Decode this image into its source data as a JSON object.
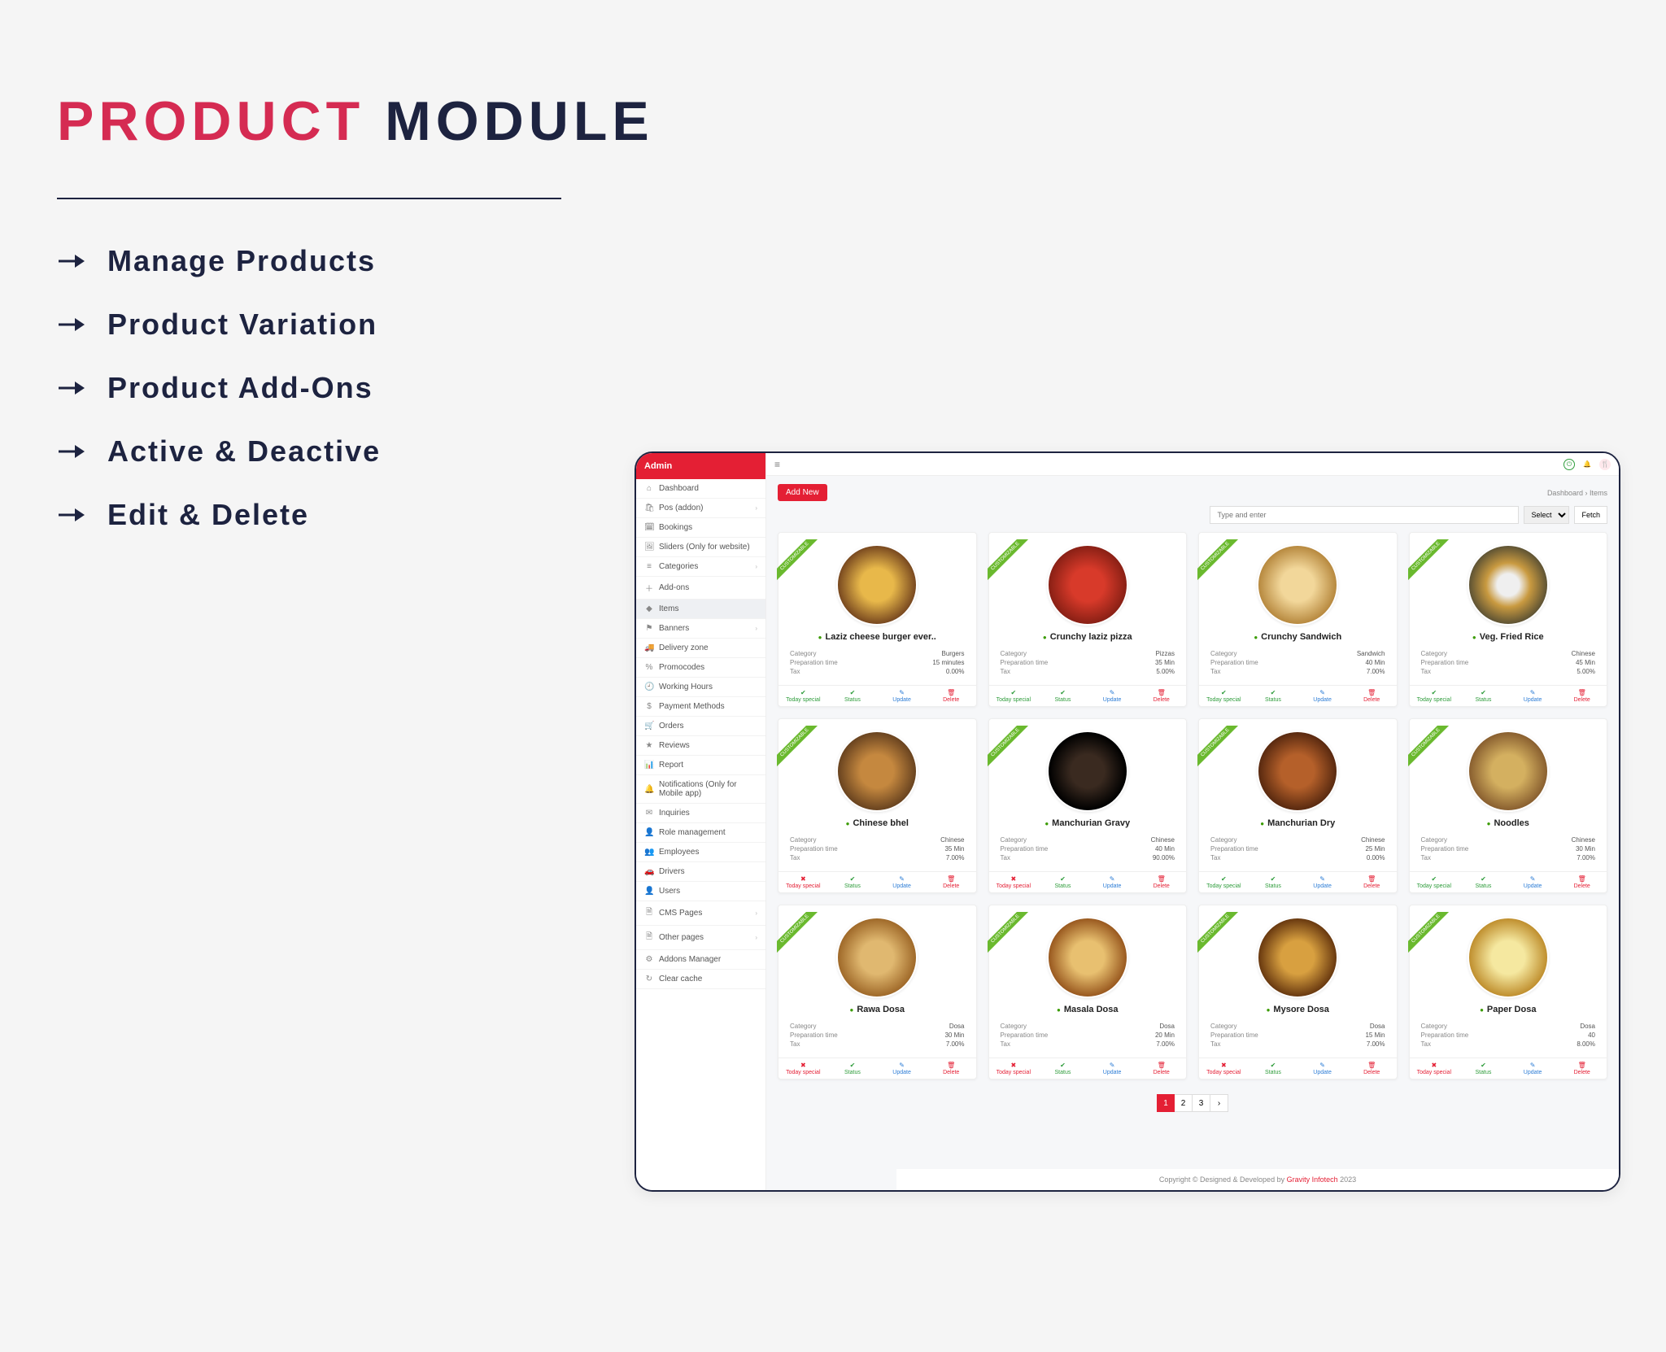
{
  "headline": {
    "word1": "PRODUCT",
    "word2": "MODULE"
  },
  "features": [
    "Manage Products",
    "Product Variation",
    "Product Add-Ons",
    "Active & Deactive",
    "Edit & Delete"
  ],
  "sidebar": {
    "title": "Admin",
    "items": [
      {
        "icon": "⌂",
        "label": "Dashboard",
        "sub": false
      },
      {
        "icon": "🛍",
        "label": "Pos (addon)",
        "sub": true
      },
      {
        "icon": "🗓",
        "label": "Bookings",
        "sub": false
      },
      {
        "icon": "🖼",
        "label": "Sliders (Only for website)",
        "sub": false
      },
      {
        "icon": "≡",
        "label": "Categories",
        "sub": true
      },
      {
        "icon": "＋",
        "label": "Add-ons",
        "sub": false
      },
      {
        "icon": "◆",
        "label": "Items",
        "sub": false,
        "active": true
      },
      {
        "icon": "⚑",
        "label": "Banners",
        "sub": true
      },
      {
        "icon": "🚚",
        "label": "Delivery zone",
        "sub": false
      },
      {
        "icon": "%",
        "label": "Promocodes",
        "sub": false
      },
      {
        "icon": "🕘",
        "label": "Working Hours",
        "sub": false
      },
      {
        "icon": "$",
        "label": "Payment Methods",
        "sub": false
      },
      {
        "icon": "🛒",
        "label": "Orders",
        "sub": false
      },
      {
        "icon": "★",
        "label": "Reviews",
        "sub": false
      },
      {
        "icon": "📊",
        "label": "Report",
        "sub": false
      },
      {
        "icon": "🔔",
        "label": "Notifications (Only for Mobile app)",
        "sub": false
      },
      {
        "icon": "✉",
        "label": "Inquiries",
        "sub": false
      },
      {
        "icon": "👤",
        "label": "Role management",
        "sub": false
      },
      {
        "icon": "👥",
        "label": "Employees",
        "sub": false
      },
      {
        "icon": "🚗",
        "label": "Drivers",
        "sub": false
      },
      {
        "icon": "👤",
        "label": "Users",
        "sub": false
      },
      {
        "icon": "🗎",
        "label": "CMS Pages",
        "sub": true
      },
      {
        "icon": "🗎",
        "label": "Other pages",
        "sub": true
      },
      {
        "icon": "⚙",
        "label": "Addons Manager",
        "sub": false
      },
      {
        "icon": "↻",
        "label": "Clear cache",
        "sub": false
      }
    ]
  },
  "topbar": {
    "breadcrumb_root": "Dashboard",
    "breadcrumb_leaf": "Items"
  },
  "buttons": {
    "add_new": "Add New",
    "select": "Select",
    "fetch": "Fetch"
  },
  "search_placeholder": "Type and enter",
  "product_meta_labels": {
    "category": "Category",
    "prep": "Preparation time",
    "tax": "Tax"
  },
  "action_labels": {
    "today": "Today special",
    "status": "Status",
    "update": "Update",
    "delete": "Delete"
  },
  "products": [
    {
      "name": "Laziz cheese burger ever..",
      "cat": "Burgers",
      "prep": "15 minutes",
      "tax": "0.00%",
      "today_green": true
    },
    {
      "name": "Crunchy laziz pizza",
      "cat": "Pizzas",
      "prep": "35 Min",
      "tax": "5.00%",
      "today_green": true
    },
    {
      "name": "Crunchy Sandwich",
      "cat": "Sandwich",
      "prep": "40 Min",
      "tax": "7.00%",
      "today_green": true
    },
    {
      "name": "Veg. Fried Rice",
      "cat": "Chinese",
      "prep": "45 Min",
      "tax": "5.00%",
      "today_green": true
    },
    {
      "name": "Chinese bhel",
      "cat": "Chinese",
      "prep": "35 Min",
      "tax": "7.00%",
      "today_green": false
    },
    {
      "name": "Manchurian Gravy",
      "cat": "Chinese",
      "prep": "40 Min",
      "tax": "90.00%",
      "today_green": false
    },
    {
      "name": "Manchurian Dry",
      "cat": "Chinese",
      "prep": "25 Min",
      "tax": "0.00%",
      "today_green": true
    },
    {
      "name": "Noodles",
      "cat": "Chinese",
      "prep": "30 Min",
      "tax": "7.00%",
      "today_green": true
    },
    {
      "name": "Rawa Dosa",
      "cat": "Dosa",
      "prep": "30 Min",
      "tax": "7.00%",
      "today_green": false
    },
    {
      "name": "Masala Dosa",
      "cat": "Dosa",
      "prep": "20 Min",
      "tax": "7.00%",
      "today_green": false
    },
    {
      "name": "Mysore Dosa",
      "cat": "Dosa",
      "prep": "15 Min",
      "tax": "7.00%",
      "today_green": false
    },
    {
      "name": "Paper Dosa",
      "cat": "Dosa",
      "prep": "40",
      "tax": "8.00%",
      "today_green": false
    }
  ],
  "ribbon_label": "CUSTOMIZABLE",
  "pagination": [
    "1",
    "2",
    "3",
    "›"
  ],
  "footer": {
    "copyright": "Copyright © Designed & Developed by ",
    "link": "Gravity Infotech",
    "year": " 2023"
  }
}
